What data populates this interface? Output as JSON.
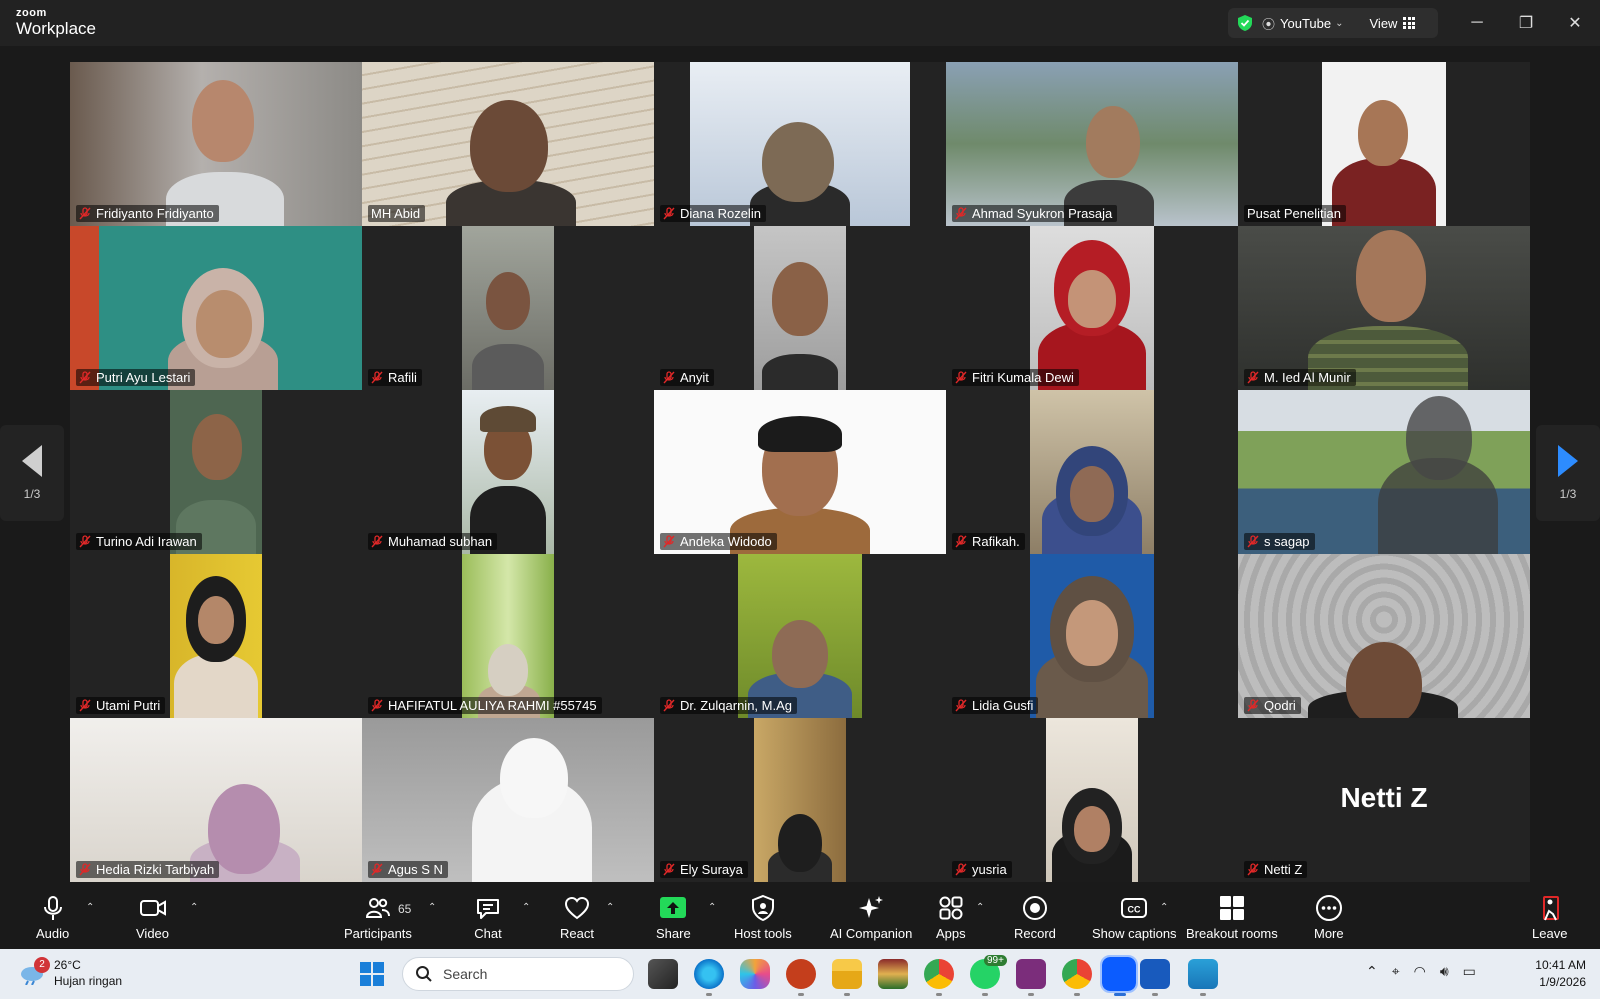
{
  "app": {
    "logo_top": "zoom",
    "logo_bottom": "Workplace"
  },
  "titlebar": {
    "stream_label": "YouTube",
    "view_label": "View"
  },
  "grid": {
    "page_indicator": "1/3",
    "participants": [
      {
        "name": "Fridiyanto Fridiyanto"
      },
      {
        "name": "MH Abid"
      },
      {
        "name": "Diana Rozelin"
      },
      {
        "name": "Ahmad Syukron Prasaja"
      },
      {
        "name": "Pusat Penelitian"
      },
      {
        "name": "Putri Ayu Lestari"
      },
      {
        "name": "Rafili"
      },
      {
        "name": "Anyit"
      },
      {
        "name": "Fitri Kumala Dewi"
      },
      {
        "name": "M. Ied Al Munir"
      },
      {
        "name": "Turino Adi Irawan"
      },
      {
        "name": "Muhamad subhan"
      },
      {
        "name": "Andeka Widodo"
      },
      {
        "name": "Rafikah."
      },
      {
        "name": "s sagap"
      },
      {
        "name": "Utami Putri"
      },
      {
        "name": "HAFIFATUL AULIYA RAHMI #55745"
      },
      {
        "name": "Dr. Zulqarnin, M.Ag"
      },
      {
        "name": "Lidia Gusfi"
      },
      {
        "name": "Qodri"
      },
      {
        "name": "Hedia Rizki Tarbiyah"
      },
      {
        "name": "Agus S N"
      },
      {
        "name": "Ely Suraya"
      },
      {
        "name": "yusria"
      },
      {
        "name": "Netti Z"
      }
    ],
    "big_name": "Netti Z"
  },
  "toolbar": {
    "audio": "Audio",
    "video": "Video",
    "participants": "Participants",
    "participants_count": "65",
    "chat": "Chat",
    "react": "React",
    "share": "Share",
    "host_tools": "Host tools",
    "ai_companion": "AI Companion",
    "apps": "Apps",
    "record": "Record",
    "captions": "Show captions",
    "breakout": "Breakout rooms",
    "more": "More",
    "leave": "Leave",
    "colors": {
      "share": "#23d959",
      "leave": "#e02828",
      "active_border": "#23d959"
    }
  },
  "taskbar": {
    "weather_temp": "26°C",
    "weather_desc": "Hujan ringan",
    "weather_badge": "2",
    "search_placeholder": "Search",
    "whatsapp_badge": "99+",
    "time": "10:41 AM",
    "date": "1/9/2026"
  }
}
